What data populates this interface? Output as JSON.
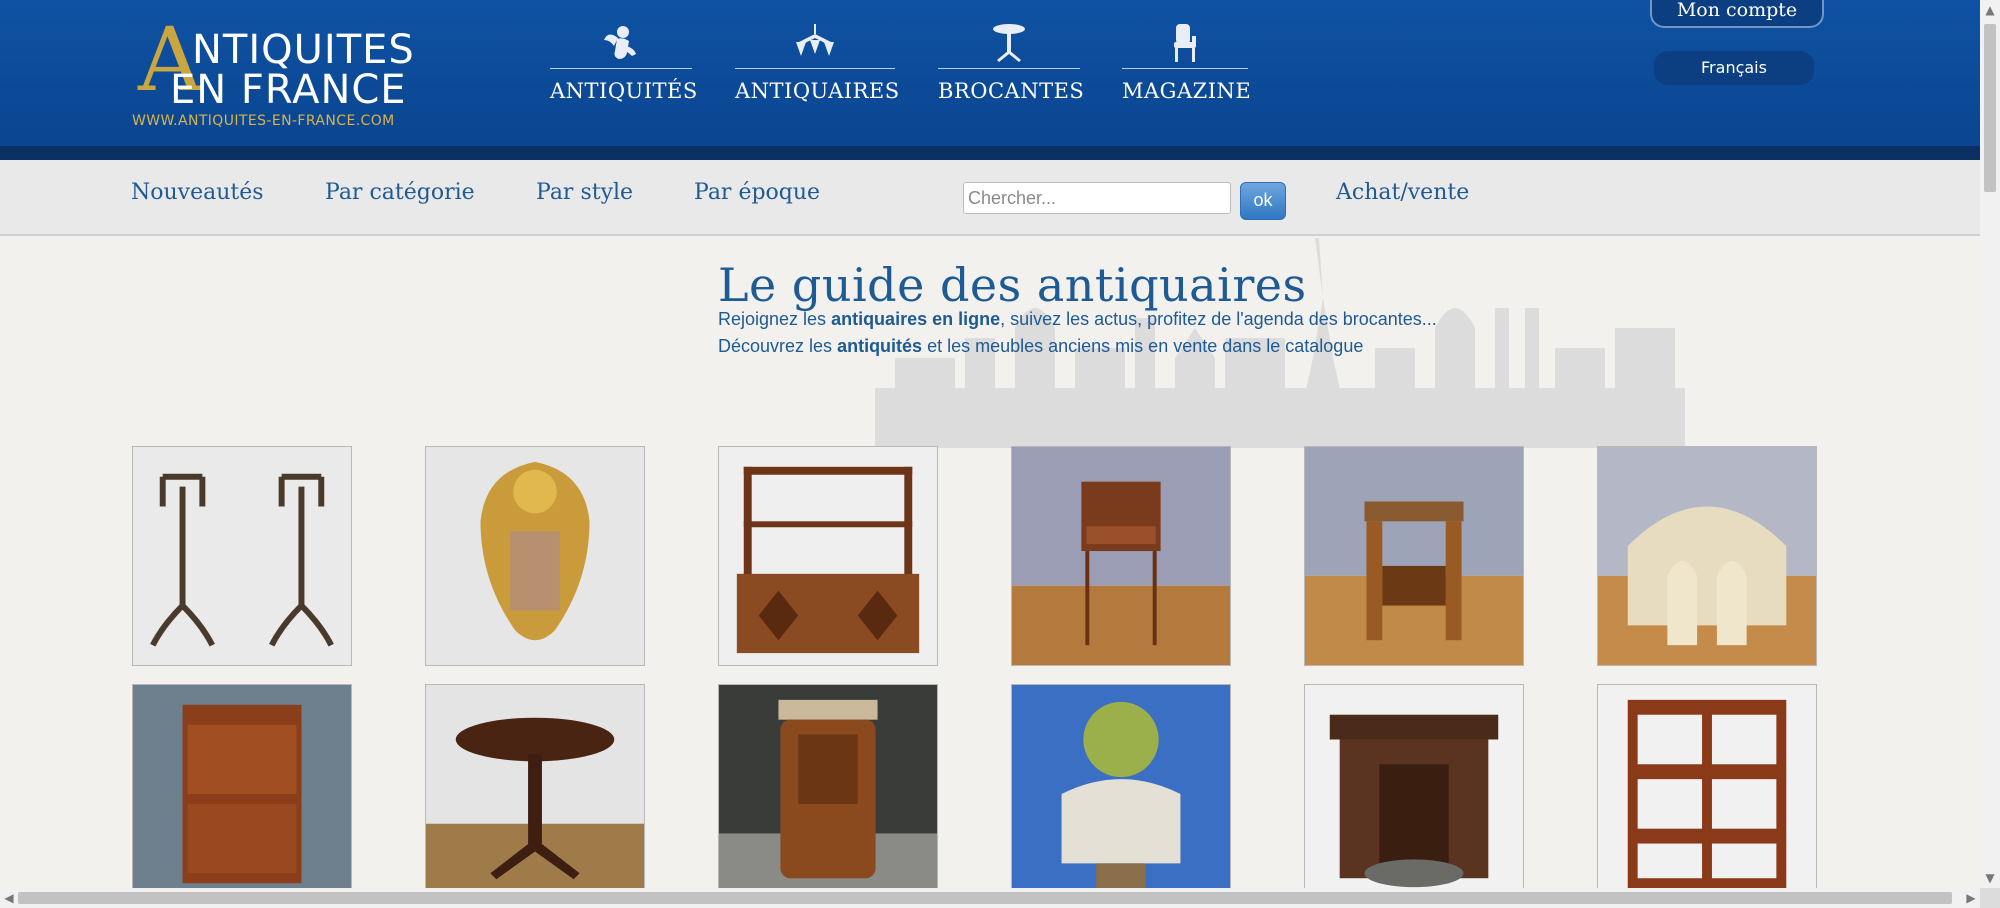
{
  "header": {
    "logo": {
      "line1": "NTIQUITES",
      "line2": "EN FRANCE",
      "url": "WWW.ANTIQUITES-EN-FRANCE.COM",
      "big_letter": "A"
    },
    "main_nav": [
      {
        "label": "ANTIQUITÉS",
        "icon": "cherub-icon"
      },
      {
        "label": "ANTIQUAIRES",
        "icon": "chandelier-icon"
      },
      {
        "label": "BROCANTES",
        "icon": "pedestal-table-icon"
      },
      {
        "label": "MAGAZINE",
        "icon": "armchair-icon"
      }
    ],
    "account_label": "Mon compte",
    "language": "Français",
    "colors": {
      "header_blue": "#0f52a3",
      "gold": "#c9a640",
      "link_blue": "#1e5a93"
    }
  },
  "sub_nav": {
    "links": [
      "Nouveautés",
      "Par catégorie",
      "Par style",
      "Par époque"
    ],
    "search": {
      "placeholder": "Chercher...",
      "value": "",
      "button": "ok"
    },
    "buy_sell": "Achat/vente"
  },
  "main": {
    "title": "Le guide des antiquaires",
    "intro1": {
      "pre": "Rejoignez les ",
      "bold": "antiquaires en ligne",
      "post": ", suivez les actus, profitez de l'agenda des brocantes..."
    },
    "intro2": {
      "pre": "Découvrez les ",
      "bold": "antiquités",
      "post": " et les meubles anciens mis en vente dans le catalogue"
    },
    "products": [
      {
        "name": "andirons"
      },
      {
        "name": "gilded-bronze-cartel"
      },
      {
        "name": "wall-shelf-cabinet"
      },
      {
        "name": "side-table"
      },
      {
        "name": "art-deco-side-table"
      },
      {
        "name": "salon-armchairs-set"
      },
      {
        "name": "secretary-desk"
      },
      {
        "name": "pedestal-round-table"
      },
      {
        "name": "art-deco-nightstand"
      },
      {
        "name": "shrek-statue"
      },
      {
        "name": "carved-wood-cabinet"
      },
      {
        "name": "revolving-bookcase"
      }
    ]
  }
}
